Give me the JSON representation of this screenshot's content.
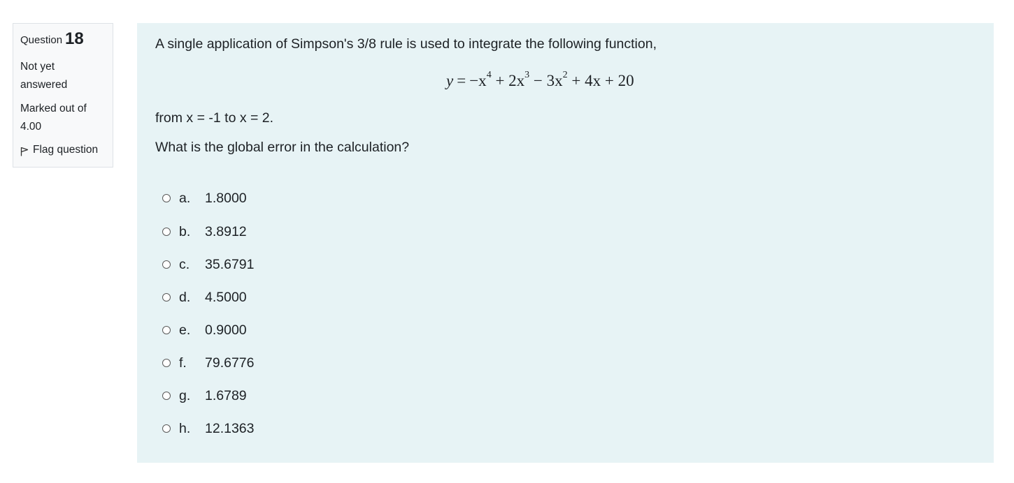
{
  "question_info": {
    "label": "Question",
    "number": "18",
    "state": "Not yet answered",
    "grade": "Marked out of 4.00",
    "flag_label": "Flag question"
  },
  "question": {
    "intro": "A single application of Simpson's 3/8 rule is used to integrate the following function,",
    "equation": {
      "lhs": "y",
      "t1": "−x",
      "e1": "4",
      "t2": "+ 2x",
      "e2": "3",
      "t3": "− 3x",
      "e3": "2",
      "t4": "+ 4x + 20"
    },
    "range": "from x = -1 to x = 2.",
    "prompt": "What is the global error in the calculation?"
  },
  "answers": [
    {
      "letter": "a.",
      "value": "1.8000"
    },
    {
      "letter": "b.",
      "value": "3.8912"
    },
    {
      "letter": "c.",
      "value": "35.6791"
    },
    {
      "letter": "d.",
      "value": "4.5000"
    },
    {
      "letter": "e.",
      "value": "0.9000"
    },
    {
      "letter": "f.",
      "value": "79.6776"
    },
    {
      "letter": "g.",
      "value": "1.6789"
    },
    {
      "letter": "h.",
      "value": "12.1363"
    }
  ]
}
